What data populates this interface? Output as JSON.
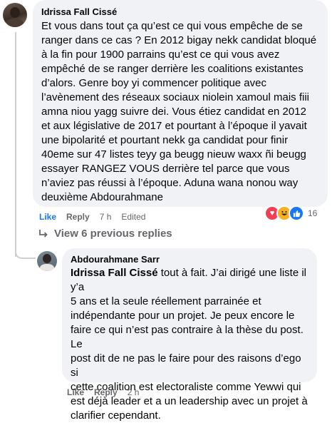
{
  "comment": {
    "author": "Idrissa Fall Cissé",
    "text": "Et vous dans tout ça qu’est ce qui vous empêche de se\nranger dans ce cas ? En 2012 bigay nekk candidat bloqué\nà la fin pour 1900 parrains qu’est ce qui vous avez\nempêché de se ranger derrière les coalitions existantes\nd’alors. Genre boy yi commencer politique avec\nl’avènement des réseaux sociaux niolein xamoul mais fiii\namna niou yagg suivre dei. Vous étiez candidat en 2012\net aux législative de 2017 et pourtant à l’époque il yavait\nune bipolarité et pourtant nekk ga candidat pour finir\n40eme sur 47 listes teyy ga beugg nieuw waxx ñi beugg\nessayer RANGEZ VOUS derrière tel parce que vous\nn’aviez pas réussi à l’époque. Aduna wana nonou way\ndeuxième Abdourahmane",
    "like_label": "Like",
    "reply_label": "Reply",
    "time": "7 h",
    "edited": "Edited",
    "reaction_count": "16"
  },
  "view_replies": {
    "label": "View 6 previous replies",
    "icon": "reply-arrow-icon"
  },
  "reply": {
    "author": "Abdourahmane Sarr",
    "mention": "Idrissa Fall Cissé",
    "text": " tout à fait. J’ai dirigé une liste il y’a\n5 ans et la seule réellement parrainée et\nindépendante pour un projet. Je peux encore le\nfaire ce qui n’est pas contraire à la thèse du post. Le\npost dit de ne pas le faire pour des raisons d’ego si\ncette coalition est electoraliste comme Yewwi qui\nest déjà leader et a un leadership avec un projet à\nclarifier cependant.",
    "like_label": "Like",
    "reply_label": "Reply",
    "time": "2 h"
  },
  "colors": {
    "bubble": "#f0f2f5",
    "like_blue": "#1877f2",
    "meta_gray": "#65676b"
  }
}
